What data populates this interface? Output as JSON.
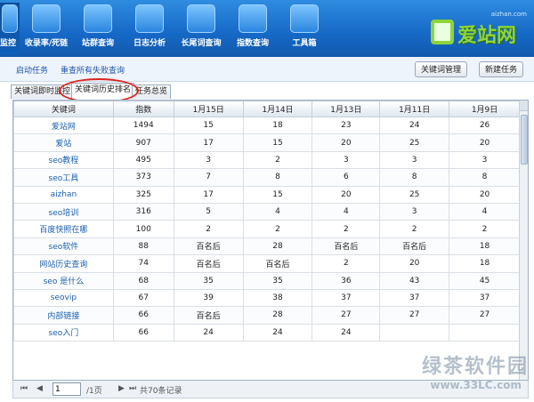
{
  "toolbar": {
    "items": [
      {
        "label": "监控",
        "icon": "monitor-icon",
        "active": true
      },
      {
        "label": "收录率/死链",
        "icon": "www-icon"
      },
      {
        "label": "站群查询",
        "icon": "search-icon"
      },
      {
        "label": "日志分析",
        "icon": "bar-chart-icon"
      },
      {
        "label": "长尾词查询",
        "icon": "paper-plane-icon"
      },
      {
        "label": "指数查询",
        "icon": "index-icon"
      },
      {
        "label": "工具箱",
        "icon": "tools-icon"
      }
    ]
  },
  "brand": {
    "site": "aizhan.com",
    "name": "爱站网"
  },
  "links": {
    "start_task": "启动任务",
    "recheck_failed": "重查所有失败查询"
  },
  "buttons": {
    "keyword_manage": "关键词管理",
    "new_task": "新建任务"
  },
  "tabs": [
    "关键词即时监控",
    "关键词历史排名",
    "任务总览"
  ],
  "table": {
    "headers": [
      "关键词",
      "指数",
      "1月15日",
      "1月14日",
      "1月13日",
      "1月11日",
      "1月9日"
    ],
    "rows": [
      [
        "爱站网",
        "1494",
        "15",
        "18",
        "23",
        "24",
        "26"
      ],
      [
        "爱站",
        "907",
        "17",
        "15",
        "20",
        "25",
        "20"
      ],
      [
        "seo教程",
        "495",
        "3",
        "2",
        "3",
        "3",
        "3"
      ],
      [
        "seo工具",
        "373",
        "7",
        "8",
        "6",
        "8",
        "8"
      ],
      [
        "aizhan",
        "325",
        "17",
        "15",
        "20",
        "25",
        "20"
      ],
      [
        "seo培训",
        "316",
        "5",
        "4",
        "4",
        "3",
        "4"
      ],
      [
        "百度快照在哪",
        "100",
        "2",
        "2",
        "2",
        "2",
        "2"
      ],
      [
        "seo软件",
        "88",
        "百名后",
        "28",
        "百名后",
        "百名后",
        "18"
      ],
      [
        "网站历史查询",
        "74",
        "百名后",
        "百名后",
        "2",
        "20",
        "18"
      ],
      [
        "seo 是什么",
        "68",
        "35",
        "35",
        "36",
        "43",
        "45"
      ],
      [
        "seovip",
        "67",
        "39",
        "38",
        "37",
        "37",
        "37"
      ],
      [
        "内部链接",
        "66",
        "百名后",
        "28",
        "27",
        "27",
        "27"
      ],
      [
        "seo入门",
        "66",
        "24",
        "24",
        "24",
        "",
        ""
      ]
    ]
  },
  "pager": {
    "page": "1",
    "total_pages": "/1页",
    "total_records": "共70条记录"
  },
  "watermark": {
    "cn": "绿茶软件园",
    "en": "www.33LC.com"
  }
}
